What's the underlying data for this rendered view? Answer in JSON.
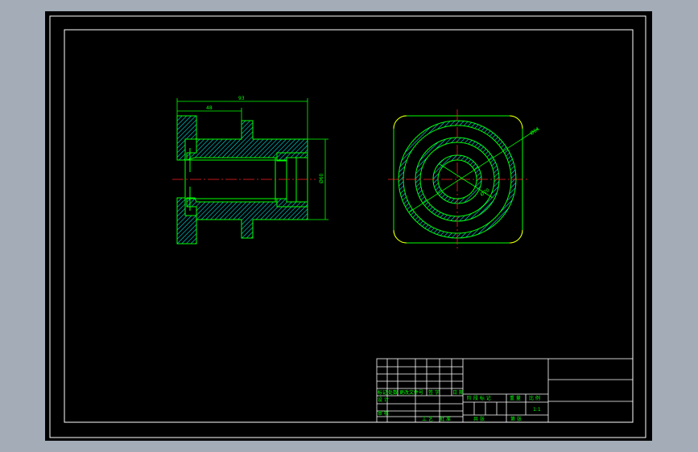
{
  "colors": {
    "background": "#a3acb7",
    "sheet": "#000000",
    "border": "#ffffff",
    "outline": "#00ff00",
    "hatch": "#00e5e5",
    "centerline": "#ff2020",
    "corner_arc": "#ffff00",
    "dimension": "#00ff00"
  },
  "section_view": {
    "dimensions": {
      "overall_length": "93",
      "flange_length": "48",
      "diameter": "Ø60"
    }
  },
  "end_view": {
    "dimensions": {
      "outer_diameter": "Ø64",
      "inner_diameter": "Ø20"
    }
  },
  "title_block": {
    "row_labels": {
      "mark": "标记",
      "count": "处数",
      "document_no": "更改文件号",
      "signature": "签 字",
      "date": "日 期",
      "designer": "设 计",
      "approve": "审 核",
      "craft": "工 艺",
      "stage_mark": "阶 段 标 记",
      "weight": "重 量",
      "ratio": "比 例",
      "scale_value": "1:1",
      "total_sheets": "共 张",
      "sheet_no": "第 张",
      "approved": "批 准"
    }
  }
}
